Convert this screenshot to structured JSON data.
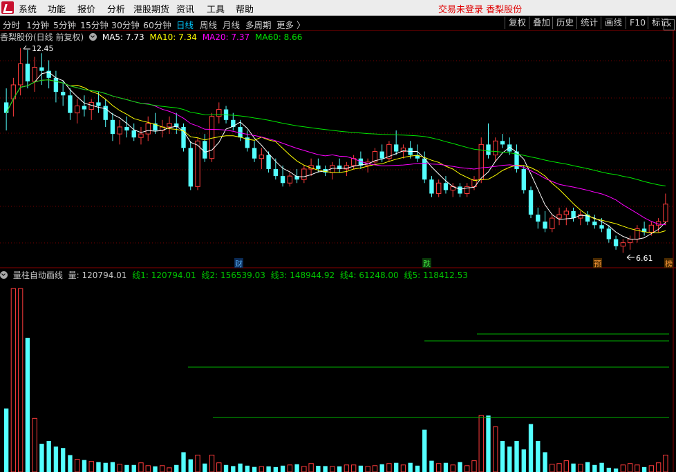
{
  "menu": {
    "items": [
      "系统",
      "功能",
      "报价",
      "分析",
      "港股期货",
      "资讯",
      "工具",
      "帮助"
    ],
    "status": "交易未登录 香梨股份"
  },
  "periods": {
    "items": [
      "分时",
      "1分钟",
      "5分钟",
      "15分钟",
      "30分钟",
      "60分钟",
      "日线",
      "周线",
      "月线",
      "多周期",
      "更多 〉"
    ],
    "active": "日线"
  },
  "toolbar": {
    "buttons": [
      "复权",
      "叠加",
      "历史",
      "统计",
      "画线",
      "F10",
      "标记"
    ],
    "close_label": "×"
  },
  "main_info": {
    "title": "香梨股份(日线 前复权)",
    "ma5": "MA5: 7.73",
    "ma10": "MA10: 7.34",
    "ma20": "MA20: 7.37",
    "ma60": "MA60: 8.66"
  },
  "price_labels": {
    "high": "12.45",
    "low": "6.61"
  },
  "event_tags": [
    "财",
    "跌",
    "预",
    "榜"
  ],
  "vol_info": {
    "title": "量柱自动画线",
    "vol": "量: 120794.01",
    "x1": "线1: 120794.01",
    "x2": "线2: 156539.03",
    "x3": "线3: 148944.92",
    "x4": "线4: 61248.00",
    "x5": "线5: 118412.53"
  },
  "colors": {
    "up": "#ff3c3c",
    "down": "#54ffff",
    "ma5": "#ffffff",
    "ma10": "#ffff00",
    "ma20": "#ff00ff",
    "ma60": "#00e600",
    "grid": "#7a0000",
    "hline": "#00b400"
  },
  "chart_data": {
    "type": "candlestick",
    "ohlc": [
      [
        10.9,
        11.3,
        10.1,
        10.6
      ],
      [
        11.0,
        11.6,
        10.5,
        11.4
      ],
      [
        11.4,
        12.45,
        11.1,
        12.0
      ],
      [
        12.0,
        12.4,
        11.3,
        11.5
      ],
      [
        11.5,
        12.2,
        11.2,
        11.9
      ],
      [
        11.9,
        12.3,
        11.4,
        11.8
      ],
      [
        11.8,
        12.1,
        11.3,
        11.6
      ],
      [
        11.6,
        11.8,
        10.9,
        11.2
      ],
      [
        11.2,
        11.5,
        10.8,
        11.1
      ],
      [
        11.1,
        11.3,
        10.4,
        10.6
      ],
      [
        10.6,
        11.0,
        10.3,
        10.8
      ],
      [
        10.8,
        11.1,
        10.5,
        10.7
      ],
      [
        10.7,
        11.0,
        10.4,
        10.9
      ],
      [
        10.9,
        11.2,
        10.6,
        10.8
      ],
      [
        10.8,
        11.0,
        10.2,
        10.4
      ],
      [
        10.4,
        10.6,
        9.8,
        10.0
      ],
      [
        10.0,
        10.4,
        9.7,
        10.2
      ],
      [
        10.2,
        10.5,
        9.9,
        10.1
      ],
      [
        10.1,
        10.3,
        9.8,
        9.9
      ],
      [
        9.9,
        10.2,
        9.7,
        10.0
      ],
      [
        10.0,
        10.5,
        9.8,
        10.3
      ],
      [
        10.3,
        10.6,
        10.0,
        10.1
      ],
      [
        10.1,
        10.4,
        9.9,
        10.2
      ],
      [
        10.2,
        10.5,
        10.0,
        10.3
      ],
      [
        10.3,
        10.6,
        10.0,
        10.2
      ],
      [
        10.2,
        10.3,
        9.5,
        9.6
      ],
      [
        9.6,
        9.8,
        8.4,
        8.5
      ],
      [
        8.5,
        9.9,
        8.4,
        9.8
      ],
      [
        9.8,
        10.0,
        9.2,
        9.3
      ],
      [
        9.3,
        10.6,
        9.2,
        10.5
      ],
      [
        10.5,
        10.9,
        10.3,
        10.7
      ],
      [
        10.7,
        10.8,
        10.3,
        10.4
      ],
      [
        10.4,
        10.6,
        10.1,
        10.2
      ],
      [
        10.2,
        10.4,
        9.8,
        9.9
      ],
      [
        9.9,
        10.1,
        9.5,
        9.6
      ],
      [
        9.6,
        9.8,
        9.2,
        9.3
      ],
      [
        9.3,
        9.6,
        9.0,
        9.4
      ],
      [
        9.4,
        9.5,
        8.9,
        9.0
      ],
      [
        9.0,
        9.3,
        8.7,
        8.8
      ],
      [
        8.8,
        9.1,
        8.5,
        8.6
      ],
      [
        8.6,
        8.9,
        8.5,
        8.8
      ],
      [
        8.8,
        9.0,
        8.6,
        8.7
      ],
      [
        8.7,
        9.1,
        8.6,
        9.0
      ],
      [
        9.0,
        9.3,
        8.8,
        9.1
      ],
      [
        9.1,
        9.3,
        8.9,
        9.0
      ],
      [
        9.0,
        9.1,
        8.8,
        8.9
      ],
      [
        8.9,
        9.2,
        8.7,
        9.1
      ],
      [
        9.1,
        9.3,
        8.9,
        9.0
      ],
      [
        9.0,
        9.2,
        8.8,
        9.1
      ],
      [
        9.1,
        9.4,
        9.0,
        9.3
      ],
      [
        9.3,
        9.5,
        9.0,
        9.1
      ],
      [
        9.1,
        9.3,
        8.9,
        9.2
      ],
      [
        9.2,
        9.6,
        9.1,
        9.5
      ],
      [
        9.5,
        9.7,
        9.2,
        9.3
      ],
      [
        9.3,
        9.8,
        9.2,
        9.7
      ],
      [
        9.7,
        10.1,
        9.4,
        9.5
      ],
      [
        9.5,
        9.7,
        9.3,
        9.6
      ],
      [
        9.6,
        9.8,
        9.3,
        9.4
      ],
      [
        9.4,
        9.7,
        9.2,
        9.3
      ],
      [
        9.3,
        9.5,
        8.6,
        8.7
      ],
      [
        8.7,
        8.8,
        8.2,
        8.3
      ],
      [
        8.3,
        8.7,
        8.2,
        8.6
      ],
      [
        8.6,
        8.8,
        8.3,
        8.4
      ],
      [
        8.4,
        8.6,
        8.2,
        8.5
      ],
      [
        8.5,
        8.6,
        8.2,
        8.3
      ],
      [
        8.3,
        8.6,
        8.2,
        8.5
      ],
      [
        8.5,
        8.8,
        8.4,
        8.7
      ],
      [
        8.7,
        9.9,
        8.6,
        9.7
      ],
      [
        9.7,
        10.3,
        9.3,
        9.4
      ],
      [
        9.4,
        9.9,
        9.2,
        9.8
      ],
      [
        9.8,
        10.0,
        9.6,
        9.7
      ],
      [
        9.7,
        9.9,
        9.4,
        9.5
      ],
      [
        9.5,
        9.7,
        8.9,
        9.0
      ],
      [
        9.0,
        9.1,
        8.3,
        8.4
      ],
      [
        8.4,
        8.5,
        7.6,
        7.7
      ],
      [
        7.7,
        7.9,
        7.3,
        7.5
      ],
      [
        7.5,
        7.8,
        7.2,
        7.3
      ],
      [
        7.3,
        7.7,
        7.2,
        7.6
      ],
      [
        7.6,
        7.9,
        7.4,
        7.7
      ],
      [
        7.7,
        7.9,
        7.4,
        7.8
      ],
      [
        7.8,
        7.9,
        7.5,
        7.6
      ],
      [
        7.6,
        7.8,
        7.4,
        7.7
      ],
      [
        7.7,
        7.8,
        7.4,
        7.5
      ],
      [
        7.5,
        7.7,
        7.3,
        7.4
      ],
      [
        7.4,
        7.6,
        7.2,
        7.3
      ],
      [
        7.3,
        7.4,
        6.9,
        7.0
      ],
      [
        7.0,
        7.1,
        6.7,
        6.8
      ],
      [
        6.8,
        7.0,
        6.61,
        6.9
      ],
      [
        6.9,
        7.1,
        6.7,
        7.0
      ],
      [
        7.0,
        7.4,
        6.9,
        7.3
      ],
      [
        7.3,
        7.5,
        7.1,
        7.2
      ],
      [
        7.2,
        7.5,
        7.1,
        7.4
      ],
      [
        7.4,
        7.6,
        7.2,
        7.5
      ],
      [
        7.5,
        8.3,
        7.4,
        8.0
      ]
    ],
    "volume": [
      45000,
      130000,
      130000,
      95000,
      38000,
      20000,
      22000,
      18000,
      17000,
      12000,
      9000,
      8500,
      7500,
      7000,
      6500,
      7000,
      5500,
      5000,
      5000,
      6500,
      4500,
      4000,
      4500,
      3000,
      5000,
      14000,
      9000,
      12000,
      6000,
      12000,
      6500,
      5000,
      4200,
      6000,
      4500,
      3600,
      3800,
      4000,
      3500,
      4500,
      5000,
      5500,
      4000,
      6000,
      4400,
      4200,
      3900,
      4000,
      5000,
      5000,
      4500,
      4000,
      4500,
      5500,
      6000,
      6500,
      5000,
      6500,
      4500,
      30000,
      8000,
      6000,
      6500,
      5000,
      7000,
      4500,
      8000,
      40000,
      40000,
      32000,
      22000,
      18000,
      22000,
      16000,
      34000,
      22000,
      14000,
      5500,
      6000,
      8000,
      6000,
      5500,
      7000,
      5000,
      6500,
      3000,
      2500,
      5000,
      6000,
      5000,
      3500,
      4500,
      6500,
      12000
    ],
    "volume_lines": [
      120794.01,
      156539.03,
      148944.92,
      61248.0,
      118412.53
    ]
  }
}
